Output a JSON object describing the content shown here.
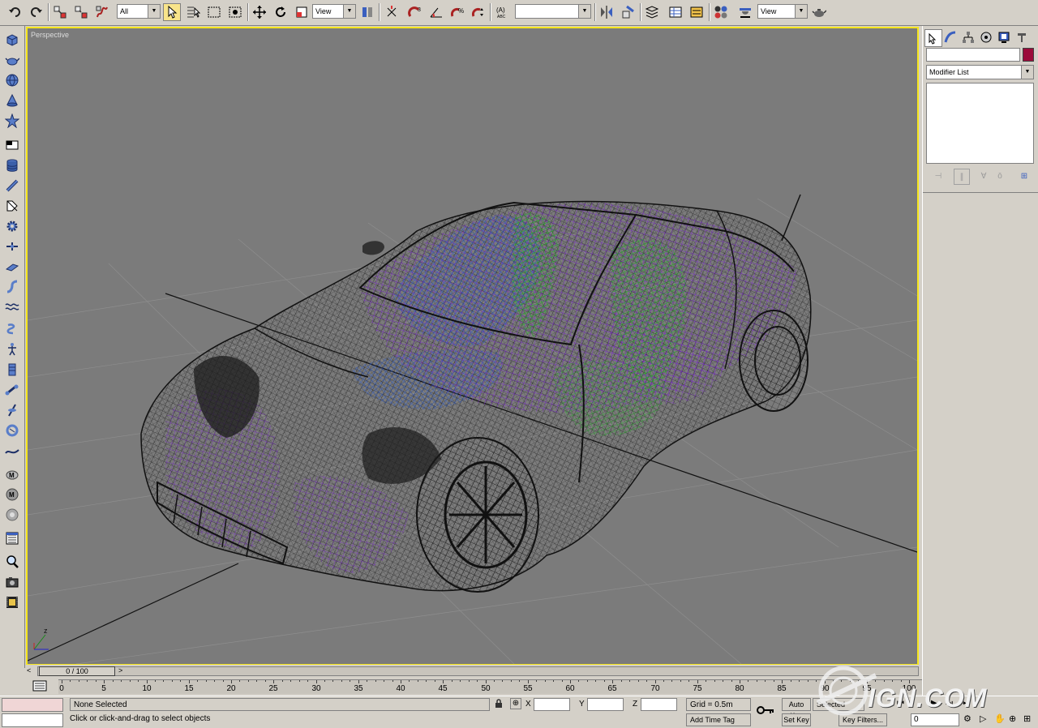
{
  "toolbar": {
    "selection_filter": "All",
    "ref_coord": "View",
    "named_sel": "",
    "render_type": "View"
  },
  "viewport": {
    "label": "Perspective"
  },
  "command_panel": {
    "object_name": "",
    "object_color": "#9b0b3a",
    "modifier_list": "Modifier List"
  },
  "time_slider": {
    "frame": "0 / 100",
    "left_arrow": "<",
    "right_arrow": ">"
  },
  "trackbar": {
    "ticks": [
      "0",
      "5",
      "10",
      "15",
      "20",
      "25",
      "30",
      "35",
      "40",
      "45",
      "50",
      "55",
      "60",
      "65",
      "70",
      "75",
      "80",
      "85",
      "90",
      "95",
      "100"
    ]
  },
  "status": {
    "selection": "None Selected",
    "prompt": "Click or click-and-drag to select objects",
    "x_label": "X",
    "y_label": "Y",
    "z_label": "Z",
    "x_value": "",
    "y_value": "",
    "z_value": "",
    "grid": "Grid = 0.5m",
    "add_time_tag": "Add Time Tag",
    "auto_key": "Auto Key",
    "selected": "Selected",
    "set_key": "Set Key",
    "key_filters": "Key Filters...",
    "current_frame": "0"
  },
  "watermark": "IGN.COM"
}
